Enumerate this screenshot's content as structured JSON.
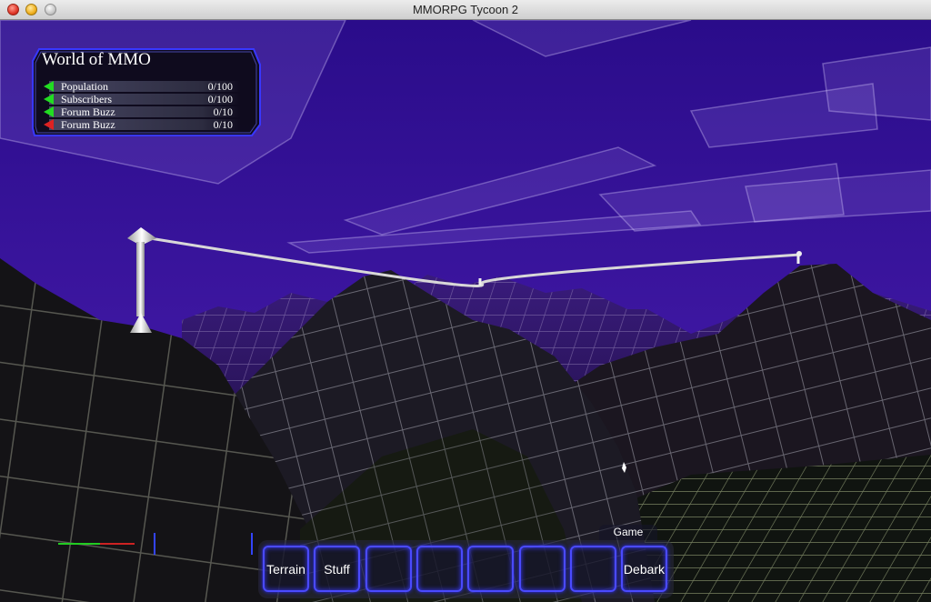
{
  "window": {
    "title": "MMORPG Tycoon 2"
  },
  "stats_panel": {
    "world_name": "World of MMO",
    "rows": [
      {
        "label": "Population",
        "value": "0/100",
        "arrow_color": "#22dd22"
      },
      {
        "label": "Subscribers",
        "value": "0/100",
        "arrow_color": "#22dd22"
      },
      {
        "label": "Forum Buzz",
        "value": "0/10",
        "arrow_color": "#22dd22"
      },
      {
        "label": "Forum Buzz",
        "value": "0/10",
        "arrow_color": "#dd2222"
      }
    ]
  },
  "toolbar": {
    "tab_label": "Game",
    "buttons": [
      "Terrain",
      "Stuff",
      "",
      "",
      "",
      "",
      "",
      "Debark"
    ]
  },
  "colors": {
    "sky_top": "#2a0c8a",
    "sky_bottom": "#4d1fb4",
    "panel_border": "#3838ff",
    "button_border": "#4a4aff"
  }
}
